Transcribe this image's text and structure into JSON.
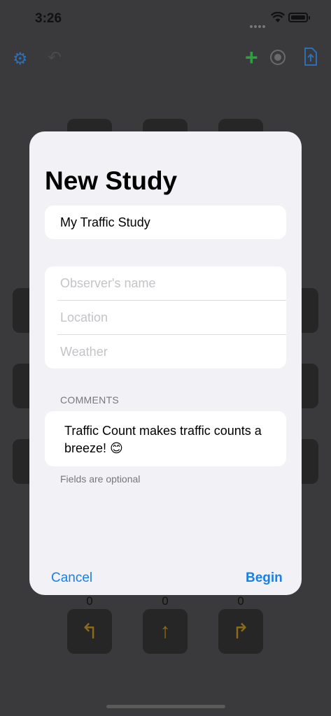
{
  "status": {
    "time": "3:26"
  },
  "modal": {
    "title": "New Study",
    "study_name": "My Traffic Study",
    "fields": {
      "observer_placeholder": "Observer's name",
      "location_placeholder": "Location",
      "weather_placeholder": "Weather"
    },
    "comments_header": "COMMENTS",
    "comments_text": "Traffic Count makes traffic counts a breeze! 😊",
    "footnote": "Fields are optional",
    "cancel_label": "Cancel",
    "begin_label": "Begin"
  },
  "counters": {
    "left": "0",
    "straight": "0",
    "right": "0"
  },
  "colors": {
    "accent": "#1a7fe6",
    "modal_bg": "#f1f1f6",
    "dim_bg": "#3a3a3c"
  }
}
